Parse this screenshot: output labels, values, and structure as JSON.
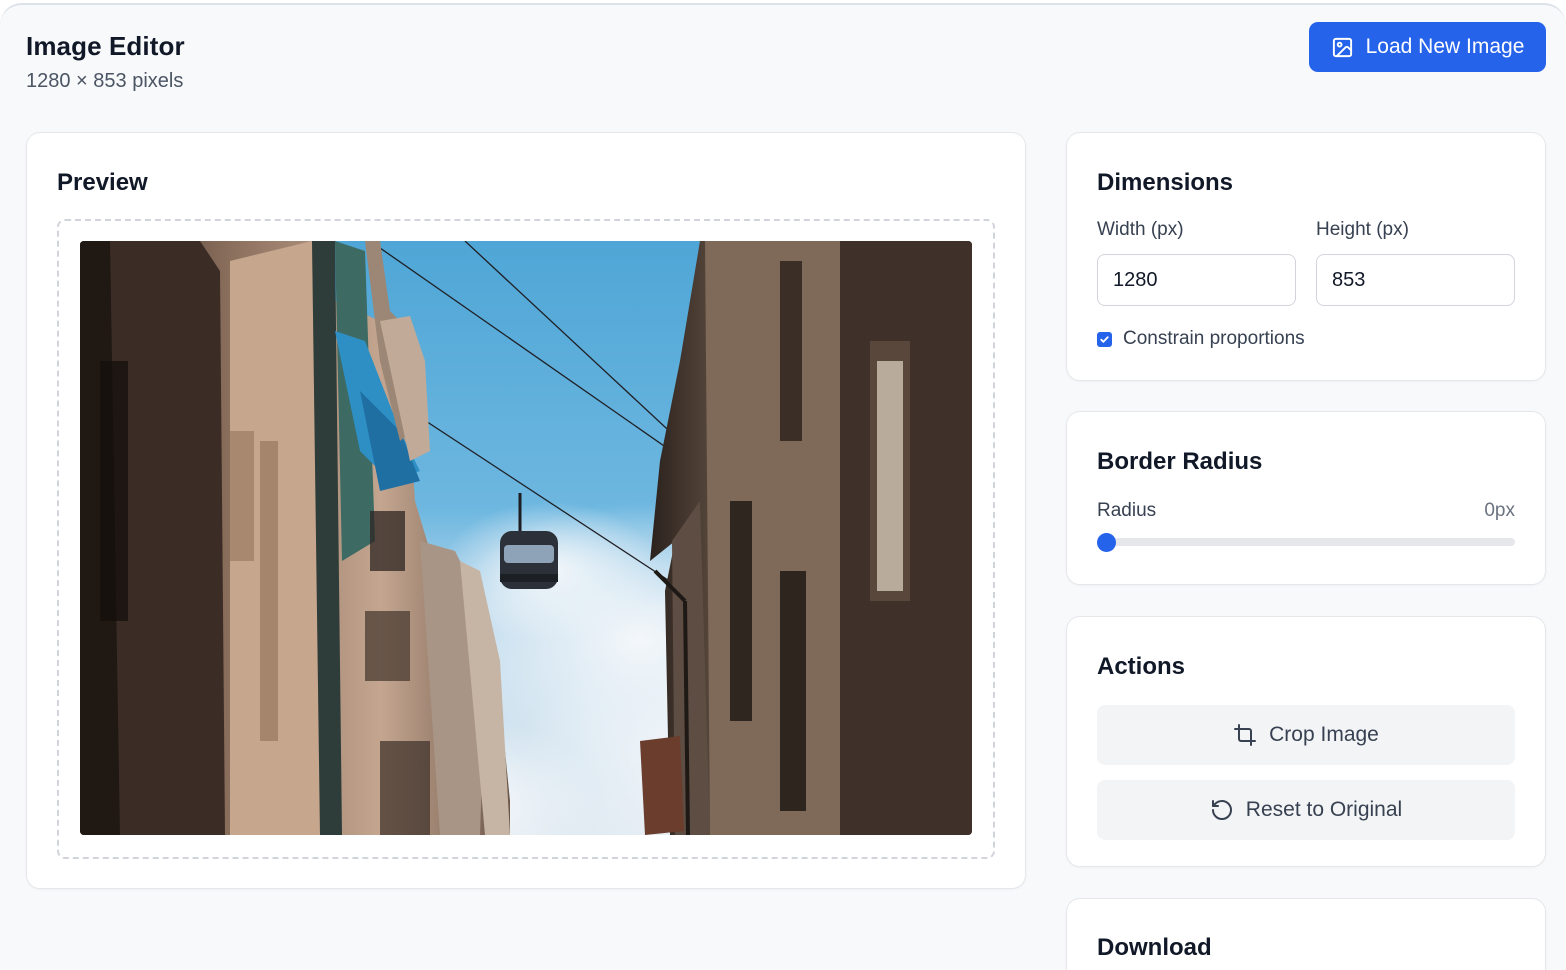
{
  "header": {
    "title": "Image Editor",
    "subtitle": "1280 × 853 pixels",
    "load_button": {
      "label": "Load New Image",
      "icon": "image-icon"
    }
  },
  "preview": {
    "title": "Preview",
    "image_alt": "Narrow street with old buildings and a cable car gondola against a blue sky"
  },
  "dimensions": {
    "title": "Dimensions",
    "width_label": "Width (px)",
    "width_value": "1280",
    "height_label": "Height (px)",
    "height_value": "853",
    "constrain_label": "Constrain proportions",
    "constrain_checked": true
  },
  "border_radius": {
    "title": "Border Radius",
    "radius_label": "Radius",
    "radius_display": "0px",
    "radius_value": 0
  },
  "actions": {
    "title": "Actions",
    "crop_label": "Crop Image",
    "crop_icon": "crop-icon",
    "reset_label": "Reset to Original",
    "reset_icon": "rotate-ccw-icon"
  },
  "download": {
    "title": "Download"
  },
  "colors": {
    "accent": "#2563eb",
    "page_bg": "#f8f9fb",
    "card_bg": "#ffffff",
    "action_bg": "#f3f4f6"
  }
}
